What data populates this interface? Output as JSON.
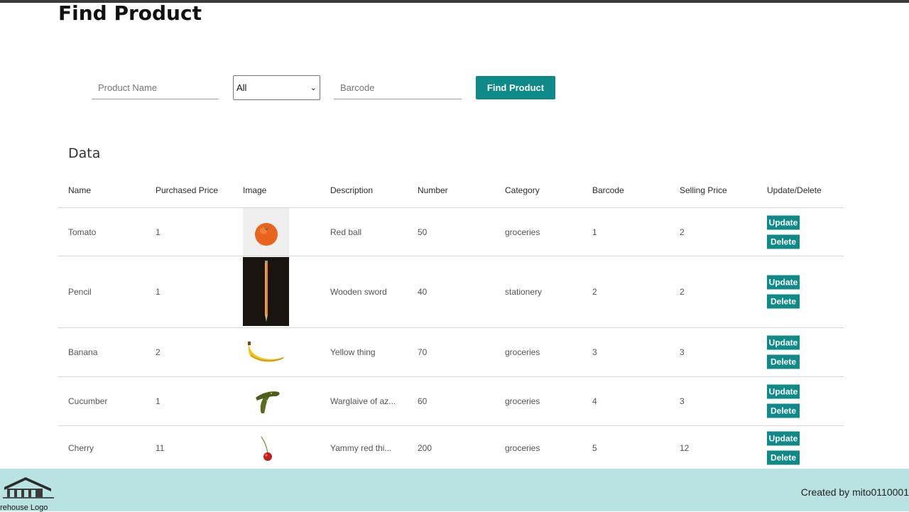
{
  "page": {
    "title": "Find Product"
  },
  "search": {
    "name_placeholder": "Product Name",
    "category_selected": "All",
    "barcode_placeholder": "Barcode",
    "submit_label": "Find Product"
  },
  "data_section": {
    "title": "Data"
  },
  "table": {
    "headers": [
      "Name",
      "Purchased Price",
      "Image",
      "Description",
      "Number",
      "Category",
      "Barcode",
      "Selling Price",
      "Update/Delete"
    ],
    "rows": [
      {
        "name": "Tomato",
        "purchased_price": "1",
        "image": "tomato",
        "description": "Red ball",
        "number": "50",
        "category": "groceries",
        "barcode": "1",
        "selling_price": "2"
      },
      {
        "name": "Pencil",
        "purchased_price": "1",
        "image": "pencil",
        "description": "Wooden sword",
        "number": "40",
        "category": "stationery",
        "barcode": "2",
        "selling_price": "2"
      },
      {
        "name": "Banana",
        "purchased_price": "2",
        "image": "banana",
        "description": "Yellow thing",
        "number": "70",
        "category": "groceries",
        "barcode": "3",
        "selling_price": "3"
      },
      {
        "name": "Cucumber",
        "purchased_price": "1",
        "image": "cucumber",
        "description": "Warglaive of az...",
        "number": "60",
        "category": "groceries",
        "barcode": "4",
        "selling_price": "3"
      },
      {
        "name": "Cherry",
        "purchased_price": "11",
        "image": "cherry",
        "description": "Yammy red thi...",
        "number": "200",
        "category": "groceries",
        "barcode": "5",
        "selling_price": "12"
      }
    ],
    "update_label": "Update",
    "delete_label": "Delete"
  },
  "footer": {
    "logo_text": "arehouse Logo",
    "credit": "Created by mito0110001"
  },
  "colors": {
    "accent": "#0f8a88",
    "footer_bg": "#b8e3e1"
  }
}
